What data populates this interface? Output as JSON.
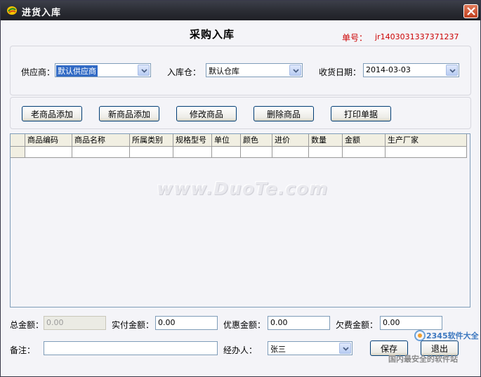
{
  "window": {
    "title": "进货入库",
    "close_glyph": "×"
  },
  "heading": "采购入库",
  "order": {
    "label": "单号：",
    "value": "jr1403031337371237"
  },
  "filters": {
    "supplier_label": "供应商：",
    "supplier_value": "默认供应商",
    "warehouse_label": "入库仓：",
    "warehouse_value": "默认仓库",
    "date_label": "收货日期：",
    "date_value": "2014-03-03"
  },
  "toolbar": {
    "add_old": "老商品添加",
    "add_new": "新商品添加",
    "edit": "修改商品",
    "delete": "删除商品",
    "print": "打印单据"
  },
  "table": {
    "columns": [
      "商品编码",
      "商品名称",
      "所属类别",
      "规格型号",
      "单位",
      "颜色",
      "进价",
      "数量",
      "金额",
      "生产厂家"
    ]
  },
  "watermark": "www.DuoTe.com",
  "footer": {
    "total_label": "总金额：",
    "total_value": "0.00",
    "paid_label": "实付金额：",
    "paid_value": "0.00",
    "discount_label": "优惠金额：",
    "discount_value": "0.00",
    "debt_label": "欠费金额：",
    "debt_value": "0.00",
    "note_label": "备注：",
    "note_value": "",
    "operator_label": "经办人：",
    "operator_value": "张三",
    "save": "保存",
    "exit": "退出"
  },
  "overlay": {
    "brand": "2345软件大全",
    "slogan": "国内最安全的软件站"
  }
}
